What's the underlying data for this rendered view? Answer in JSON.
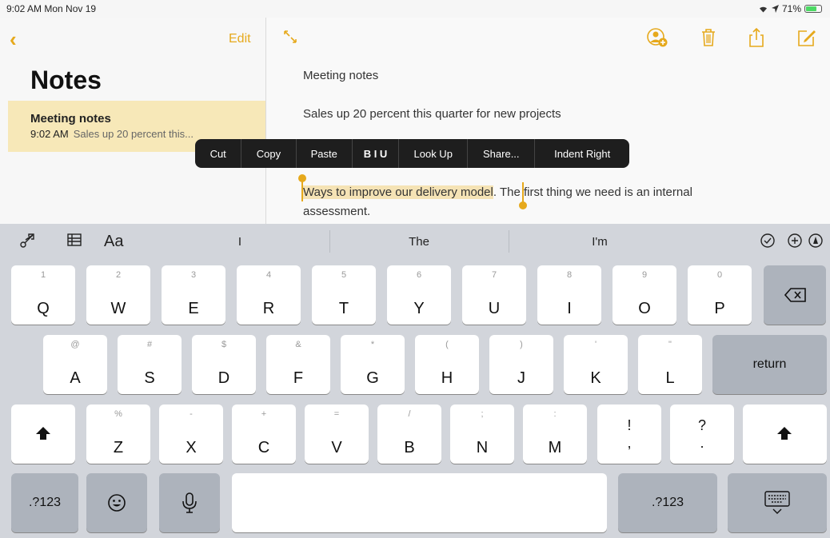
{
  "status": {
    "time": "9:02 AM  Mon Nov 19",
    "battery": "71%",
    "battery_level": 0.71
  },
  "sidebar": {
    "back_icon": "chevron-left-icon",
    "edit_label": "Edit",
    "title": "Notes",
    "note": {
      "title": "Meeting notes",
      "time": "9:02 AM",
      "snippet": "Sales up 20 percent this..."
    }
  },
  "toolbar": {
    "icons": [
      "expand-icon",
      "add-person-icon",
      "trash-icon",
      "share-icon",
      "compose-icon"
    ]
  },
  "note_body": {
    "line1": "Meeting notes",
    "line2": "Sales up 20 percent this quarter for new projects",
    "selected_text": "Ways to improve our delivery model",
    "rest_text": ". The first thing we need is an internal",
    "line4": "assessment."
  },
  "context_menu": {
    "items": [
      "Cut",
      "Copy",
      "Paste",
      "B I U",
      "Look Up",
      "Share...",
      "Indent Right"
    ]
  },
  "keyboard": {
    "suggestions": [
      "I",
      "The",
      "I'm"
    ],
    "left_icons": [
      "scissors-icon",
      "table-icon"
    ],
    "format_label": "Aa",
    "right_icons": [
      "checkmark-circle-icon",
      "plus-circle-icon",
      "markup-pen-icon"
    ],
    "row1": [
      {
        "sec": "1",
        "pri": "Q"
      },
      {
        "sec": "2",
        "pri": "W"
      },
      {
        "sec": "3",
        "pri": "E"
      },
      {
        "sec": "4",
        "pri": "R"
      },
      {
        "sec": "5",
        "pri": "T"
      },
      {
        "sec": "6",
        "pri": "Y"
      },
      {
        "sec": "7",
        "pri": "U"
      },
      {
        "sec": "8",
        "pri": "I"
      },
      {
        "sec": "9",
        "pri": "O"
      },
      {
        "sec": "0",
        "pri": "P"
      }
    ],
    "row2": [
      {
        "sec": "@",
        "pri": "A"
      },
      {
        "sec": "#",
        "pri": "S"
      },
      {
        "sec": "$",
        "pri": "D"
      },
      {
        "sec": "&",
        "pri": "F"
      },
      {
        "sec": "*",
        "pri": "G"
      },
      {
        "sec": "(",
        "pri": "H"
      },
      {
        "sec": ")",
        "pri": "J"
      },
      {
        "sec": "'",
        "pri": "K"
      },
      {
        "sec": "\"",
        "pri": "L"
      }
    ],
    "return_label": "return",
    "row3": [
      {
        "sec": "%",
        "pri": "Z"
      },
      {
        "sec": "-",
        "pri": "X"
      },
      {
        "sec": "+",
        "pri": "C"
      },
      {
        "sec": "=",
        "pri": "V"
      },
      {
        "sec": "/",
        "pri": "B"
      },
      {
        "sec": ";",
        "pri": "N"
      },
      {
        "sec": ":",
        "pri": "M"
      }
    ],
    "punct1": {
      "top": "!",
      "bottom": ","
    },
    "punct2": {
      "top": "?",
      "bottom": "."
    },
    "numbers_label": ".?123",
    "emoji_icon": "emoji-icon",
    "mic_icon": "microphone-icon",
    "hide_icon": "keyboard-dismiss-icon",
    "shift_icon": "shift-icon",
    "delete_icon": "delete-icon"
  },
  "colors": {
    "accent": "#e6a91c",
    "selection": "#f5e3b5",
    "menu": "#1e1e1e",
    "keyboard_bg": "#d2d5db"
  }
}
